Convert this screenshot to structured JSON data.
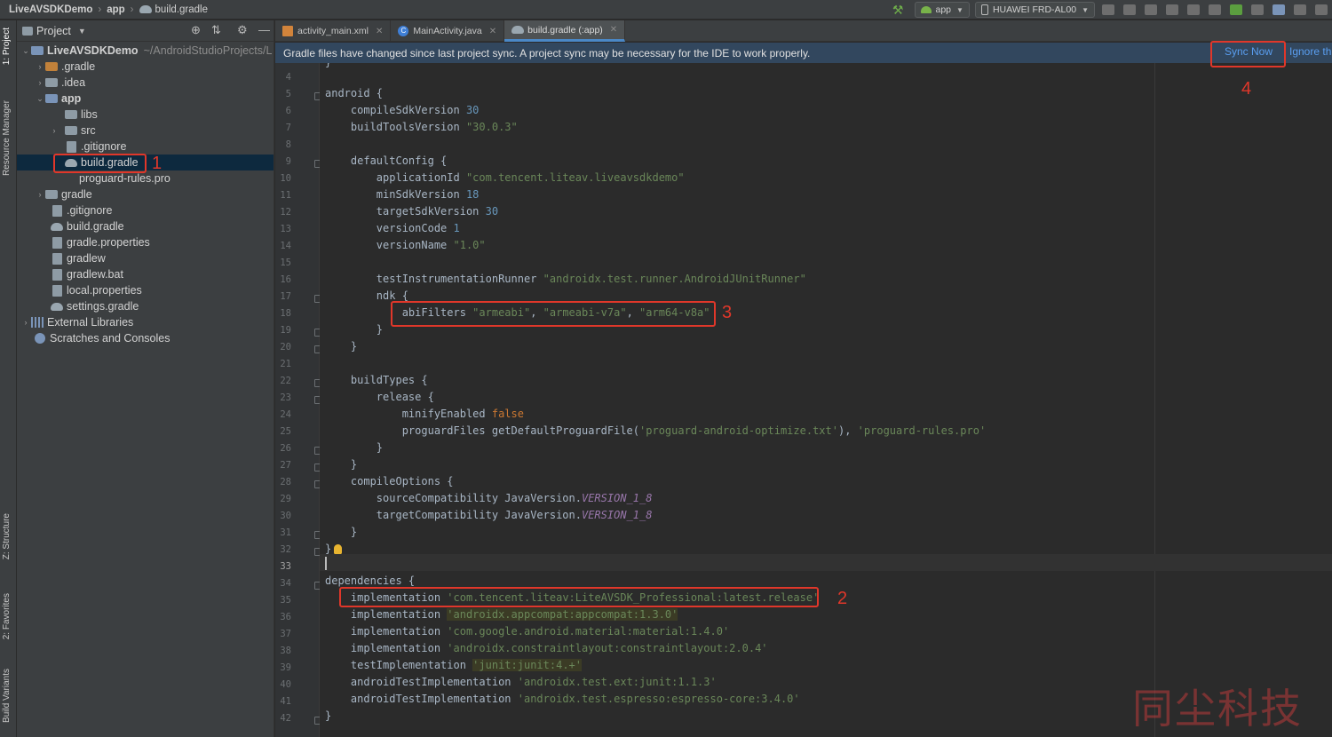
{
  "breadcrumb": {
    "project": "LiveAVSDKDemo",
    "module": "app",
    "file": "build.gradle"
  },
  "toolbar": {
    "run_config": "app",
    "device": "HUAWEI FRD-AL00"
  },
  "stripe": {
    "project_tab": "1: Project",
    "resource_tab": "Resource Manager",
    "structure_tab": "Z: Structure",
    "favorites_tab": "2: Favorites",
    "variants_tab": "Build Variants"
  },
  "project_panel": {
    "title": "Project",
    "tree": [
      {
        "label": "LiveAVSDKDemo",
        "extra": "~/AndroidStudioProjects/L",
        "icon": "project-folder-icon"
      },
      {
        "label": ".gradle",
        "icon": "folder-icon"
      },
      {
        "label": ".idea",
        "icon": "folder-icon"
      },
      {
        "label": "app",
        "icon": "module-folder-icon"
      },
      {
        "label": "libs",
        "icon": "folder-icon"
      },
      {
        "label": "src",
        "icon": "folder-icon"
      },
      {
        "label": ".gitignore",
        "icon": "file-icon"
      },
      {
        "label": "build.gradle",
        "icon": "gradle-icon"
      },
      {
        "label": "proguard-rules.pro",
        "icon": "file-icon"
      },
      {
        "label": "gradle",
        "icon": "folder-icon"
      },
      {
        "label": ".gitignore",
        "icon": "file-icon"
      },
      {
        "label": "build.gradle",
        "icon": "gradle-icon"
      },
      {
        "label": "gradle.properties",
        "icon": "file-icon"
      },
      {
        "label": "gradlew",
        "icon": "file-icon"
      },
      {
        "label": "gradlew.bat",
        "icon": "file-icon"
      },
      {
        "label": "local.properties",
        "icon": "file-icon"
      },
      {
        "label": "settings.gradle",
        "icon": "gradle-icon"
      },
      {
        "label": "External Libraries",
        "icon": "library-icon"
      },
      {
        "label": "Scratches and Consoles",
        "icon": "scratch-icon"
      }
    ]
  },
  "tabs": [
    {
      "label": "activity_main.xml"
    },
    {
      "label": "MainActivity.java"
    },
    {
      "label": "build.gradle (:app)"
    }
  ],
  "notification": {
    "message": "Gradle files have changed since last project sync. A project sync may be necessary for the IDE to work properly.",
    "sync": "Sync Now",
    "ignore": "Ignore th"
  },
  "line_numbers": [
    "4",
    "5",
    "6",
    "7",
    "8",
    "9",
    "10",
    "11",
    "12",
    "13",
    "14",
    "15",
    "16",
    "17",
    "18",
    "19",
    "20",
    "21",
    "22",
    "23",
    "24",
    "25",
    "26",
    "27",
    "28",
    "29",
    "30",
    "31",
    "32",
    "33",
    "34",
    "35",
    "36",
    "37",
    "38",
    "39",
    "40",
    "41",
    "42"
  ],
  "code": {
    "l5": "android {",
    "l6a": "    compileSdkVersion ",
    "l6b": "30",
    "l7a": "    buildToolsVersion ",
    "l7b": "\"30.0.3\"",
    "l9": "    defaultConfig {",
    "l10a": "        applicationId ",
    "l10b": "\"com.tencent.liteav.liveavsdkdemo\"",
    "l11a": "        minSdkVersion ",
    "l11b": "18",
    "l12a": "        targetSdkVersion ",
    "l12b": "30",
    "l13a": "        versionCode ",
    "l13b": "1",
    "l14a": "        versionName ",
    "l14b": "\"1.0\"",
    "l16a": "        testInstrumentationRunner ",
    "l16b": "\"androidx.test.runner.AndroidJUnitRunner\"",
    "l17": "        ndk {",
    "l18a": "            abiFilters ",
    "l18b": "\"armeabi\"",
    "l18c": ", ",
    "l18d": "\"armeabi-v7a\"",
    "l18e": ", ",
    "l18f": "\"arm64-v8a\"",
    "l19": "        }",
    "l20": "    }",
    "l22": "    buildTypes {",
    "l23": "        release {",
    "l24a": "            minifyEnabled ",
    "l24b": "false",
    "l25a": "            proguardFiles getDefaultProguardFile(",
    "l25b": "'proguard-android-optimize.txt'",
    "l25c": "), ",
    "l25d": "'proguard-rules.pro'",
    "l26": "        }",
    "l27": "    }",
    "l28": "    compileOptions {",
    "l29a": "        sourceCompatibility JavaVersion.",
    "l29b": "VERSION_1_8",
    "l30a": "        targetCompatibility JavaVersion.",
    "l30b": "VERSION_1_8",
    "l31": "    }",
    "l32": "}",
    "l34": "dependencies {",
    "l35a": "    implementation ",
    "l35b": "'com.tencent.liteav:LiteAVSDK_Professional:latest.release'",
    "l36a": "    implementation ",
    "l36b": "'androidx.appcompat:appcompat:1.3.0'",
    "l37a": "    implementation ",
    "l37b": "'com.google.android.material:material:1.4.0'",
    "l38a": "    implementation ",
    "l38b": "'androidx.constraintlayout:constraintlayout:2.0.4'",
    "l39a": "    testImplementation ",
    "l39b": "'junit:junit:4.+'",
    "l40a": "    androidTestImplementation ",
    "l40b": "'androidx.test.ext:junit:1.1.3'",
    "l41a": "    androidTestImplementation ",
    "l41b": "'androidx.test.espresso:espresso-core:3.4.0'",
    "l42": "}"
  },
  "annotations": {
    "n1": "1",
    "n2": "2",
    "n3": "3",
    "n4": "4"
  },
  "watermark": "同尘科技",
  "colors": {
    "annotation": "#e0372a",
    "link": "#5a9ef0",
    "selection": "#0d293e"
  }
}
